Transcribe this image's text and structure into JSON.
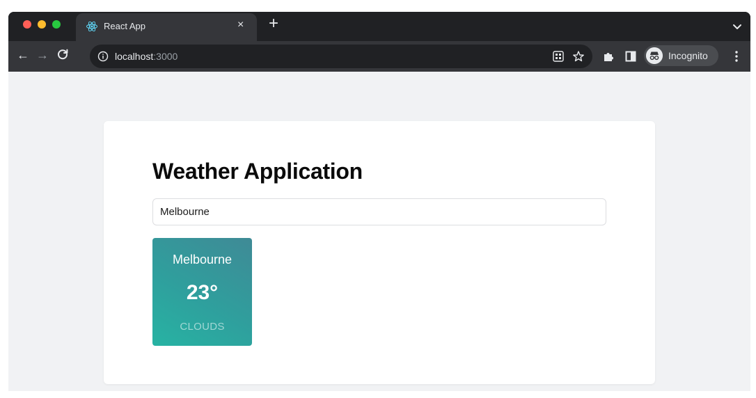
{
  "browser": {
    "tab": {
      "title": "React App",
      "close_glyph": "×",
      "favicon": "react-logo-icon"
    },
    "new_tab_glyph": "+",
    "nav": {
      "back_glyph": "←",
      "forward_glyph": "→",
      "reload_glyph": "C"
    },
    "address_bar": {
      "host": "localhost",
      "port": ":3000"
    },
    "incognito_label": "Incognito",
    "colors": {
      "frame": "#202124",
      "toolbar": "#35363a",
      "text": "#e8eaed"
    }
  },
  "app": {
    "title": "Weather Application",
    "search": {
      "value": "Melbourne"
    },
    "weather_card": {
      "city": "Melbourne",
      "temperature": "23°",
      "condition": "CLOUDS",
      "colors": {
        "from": "#27b3a3",
        "to": "#3f8a96"
      }
    }
  }
}
